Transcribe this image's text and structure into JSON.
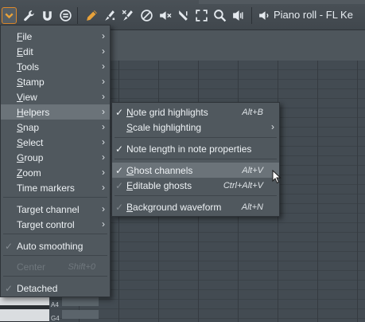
{
  "window": {
    "title": "Piano roll - FL Ke"
  },
  "toolbar": {
    "buttons": [
      {
        "name": "menu-dropdown",
        "icon": "chevron-down-icon",
        "active": true
      },
      {
        "name": "tools",
        "icon": "wrench-icon"
      },
      {
        "name": "magnet",
        "icon": "magnet-icon"
      },
      {
        "name": "snap",
        "icon": "snap-circle-icon"
      },
      {
        "name": "draw",
        "icon": "pencil-icon"
      },
      {
        "name": "paint",
        "icon": "paint-brush-icon"
      },
      {
        "name": "delete",
        "icon": "delete-brush-icon"
      },
      {
        "name": "mute",
        "icon": "mute-circle-icon"
      },
      {
        "name": "mute-speaker",
        "icon": "speaker-mute-icon"
      },
      {
        "name": "slice",
        "icon": "slice-icon"
      },
      {
        "name": "select",
        "icon": "select-icon"
      },
      {
        "name": "zoom",
        "icon": "zoom-icon"
      },
      {
        "name": "playback",
        "icon": "playback-icon"
      },
      {
        "name": "speaker",
        "icon": "speaker-icon"
      }
    ]
  },
  "piano_roll": {
    "keys": [
      "A4",
      "G4"
    ]
  },
  "main_menu": {
    "items": [
      {
        "label": "File",
        "underline": "F",
        "rest": "ile",
        "submenu": true
      },
      {
        "label": "Edit",
        "underline": "E",
        "rest": "dit",
        "submenu": true
      },
      {
        "label": "Tools",
        "underline": "T",
        "rest": "ools",
        "submenu": true
      },
      {
        "label": "Stamp",
        "underline": "S",
        "rest": "tamp",
        "submenu": true
      },
      {
        "label": "View",
        "underline": "V",
        "rest": "iew",
        "submenu": true
      },
      {
        "label": "Helpers",
        "underline": "H",
        "rest": "elpers",
        "submenu": true,
        "selected": true
      },
      {
        "label": "Snap",
        "underline": "S",
        "rest": "nap",
        "submenu": true
      },
      {
        "label": "Select",
        "underline": "S",
        "rest": "elect",
        "submenu": true
      },
      {
        "label": "Group",
        "underline": "G",
        "rest": "roup",
        "submenu": true
      },
      {
        "label": "Zoom",
        "underline": "Z",
        "rest": "oom",
        "submenu": true
      },
      {
        "label": "Time markers",
        "underline": "",
        "rest": "Time markers",
        "submenu": true
      },
      {
        "label": "Target channel",
        "underline": "",
        "rest": "Target channel",
        "submenu": true
      },
      {
        "label": "Target control",
        "underline": "",
        "rest": "Target control",
        "submenu": true
      },
      {
        "label": "Auto smoothing",
        "check": true
      },
      {
        "label": "Center",
        "shortcut": "Shift+0",
        "disabled": true
      },
      {
        "label": "Detached",
        "check": true
      }
    ]
  },
  "helpers_menu": {
    "items": [
      {
        "label": "Note grid highlights",
        "underline": "N",
        "rest": "ote grid highlights",
        "check": true,
        "shortcut": "Alt+B"
      },
      {
        "label": "Scale highlighting",
        "underline": "S",
        "rest": "cale highlighting",
        "submenu": true
      },
      {
        "label": "Note length in note properties",
        "underline": "",
        "rest": "Note length in note properties",
        "check": true
      },
      {
        "label": "Ghost channels",
        "underline": "G",
        "rest": "host channels",
        "check": true,
        "shortcut": "Alt+V",
        "selected": true
      },
      {
        "label": "Editable ghosts",
        "underline": "E",
        "rest": "ditable ghosts",
        "check": true,
        "check_dim": true,
        "shortcut": "Ctrl+Alt+V"
      },
      {
        "label": "Background waveform",
        "underline": "B",
        "rest": "ackground waveform",
        "check": true,
        "check_dim": true,
        "shortcut": "Alt+N"
      }
    ]
  },
  "glyphs": {
    "check": "✓",
    "arrow": "›"
  }
}
